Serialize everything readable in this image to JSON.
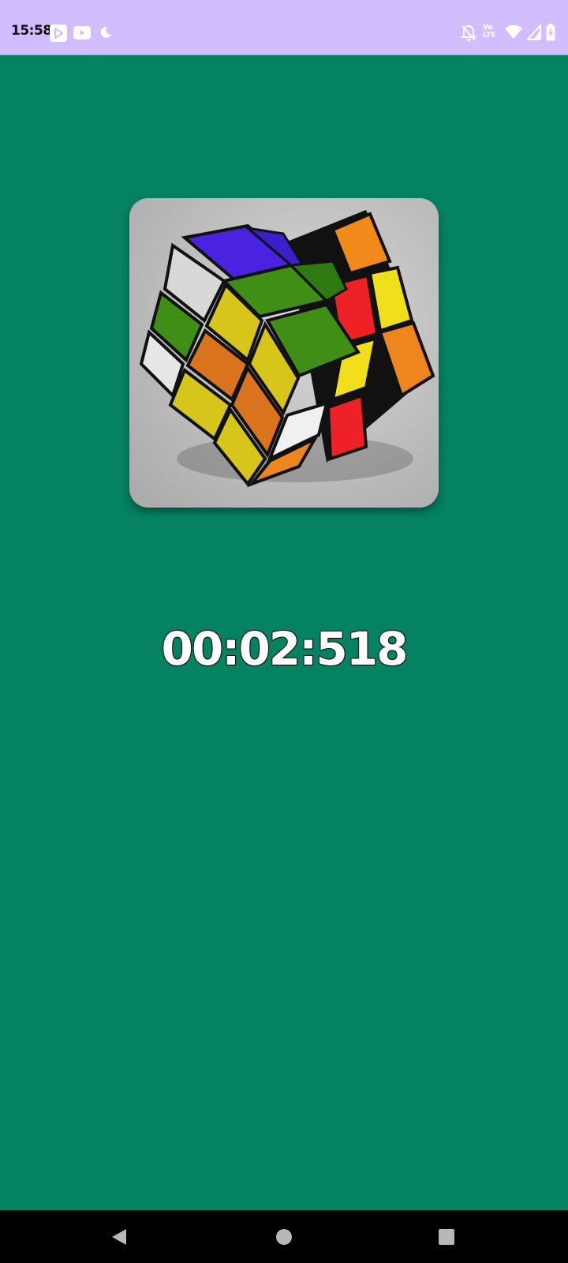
{
  "status_bar": {
    "time": "15:58",
    "left_icons": [
      "play-store-icon",
      "youtube-icon",
      "moon-icon"
    ],
    "right_icons": [
      "notifications-off-icon",
      "volte-lte-icon",
      "wifi-icon",
      "signal-icon",
      "battery-icon"
    ],
    "volte_text_top": "Vo",
    "volte_text_bottom": "LTE",
    "background": "#d1bdff"
  },
  "main": {
    "background": "#058262",
    "image_alt": "Rubik's cube",
    "timer": "00:02:518"
  },
  "nav_bar": {
    "buttons": [
      "back-icon",
      "home-icon",
      "recents-icon"
    ]
  }
}
